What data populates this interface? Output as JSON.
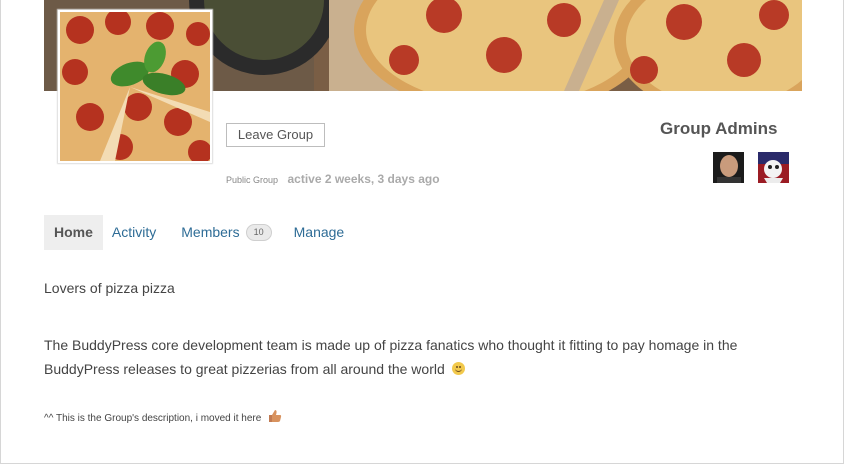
{
  "group": {
    "leave_label": "Leave Group",
    "type_label": "Public Group",
    "activity_label": "active 2 weeks, 3 days ago"
  },
  "admins": {
    "title": "Group Admins"
  },
  "nav": {
    "items": [
      {
        "label": "Home",
        "current": true
      },
      {
        "label": "Activity"
      },
      {
        "label": "Members",
        "count": "10"
      },
      {
        "label": "Manage"
      }
    ]
  },
  "description": {
    "line1": "Lovers of pizza pizza",
    "paragraph": "The BuddyPress core development team is made up of pizza fanatics who thought it fitting to pay homage in the BuddyPress releases to great pizzerias from all around the world",
    "note": "^^ This is the Group's description, i moved it here"
  },
  "colors": {
    "link": "#2e6c96",
    "text": "#444444",
    "nav_active_bg": "#eeeeee"
  },
  "icons": [
    "smiley-icon",
    "thumbs-up-icon"
  ]
}
